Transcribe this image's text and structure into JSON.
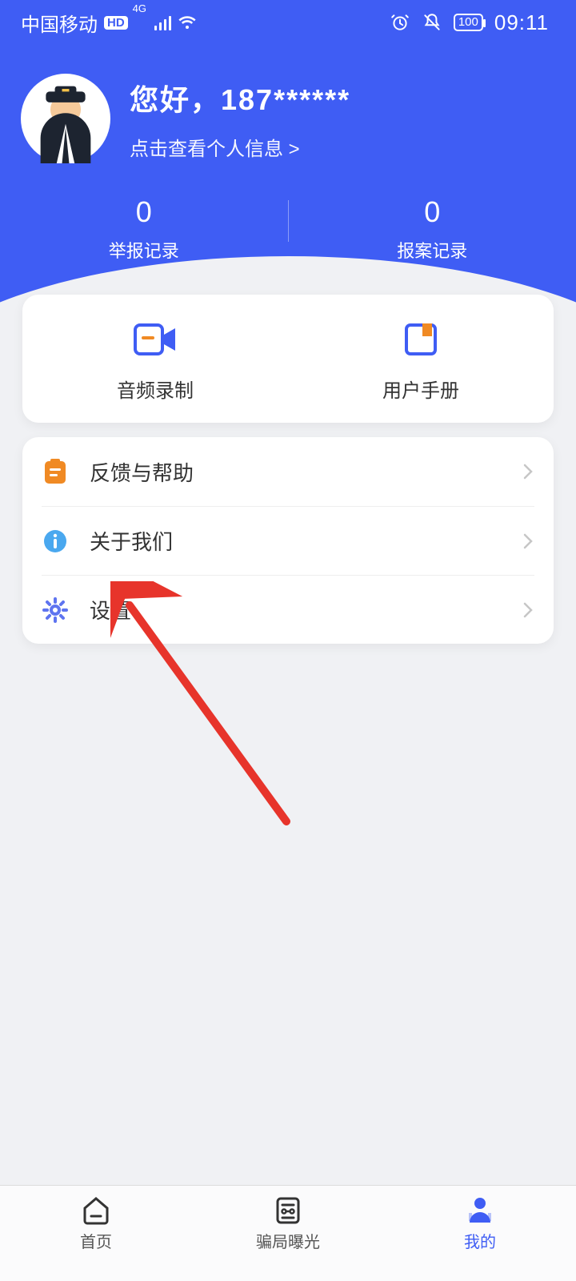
{
  "status": {
    "carrier": "中国移动",
    "hd": "HD",
    "net": "4G",
    "battery": "100",
    "time": "09:11"
  },
  "profile": {
    "greeting": "您好，187******",
    "subtitle": "点击查看个人信息 >"
  },
  "stats": [
    {
      "value": "0",
      "label": "举报记录"
    },
    {
      "value": "0",
      "label": "报案记录"
    }
  ],
  "tools": [
    {
      "label": "音频录制"
    },
    {
      "label": "用户手册"
    }
  ],
  "menu": [
    {
      "label": "反馈与帮助"
    },
    {
      "label": "关于我们"
    },
    {
      "label": "设置"
    }
  ],
  "nav": [
    {
      "label": "首页"
    },
    {
      "label": "骗局曝光"
    },
    {
      "label": "我的"
    }
  ],
  "colors": {
    "accent": "#3f5df4",
    "orange": "#f08a24",
    "red": "#e7342b"
  }
}
